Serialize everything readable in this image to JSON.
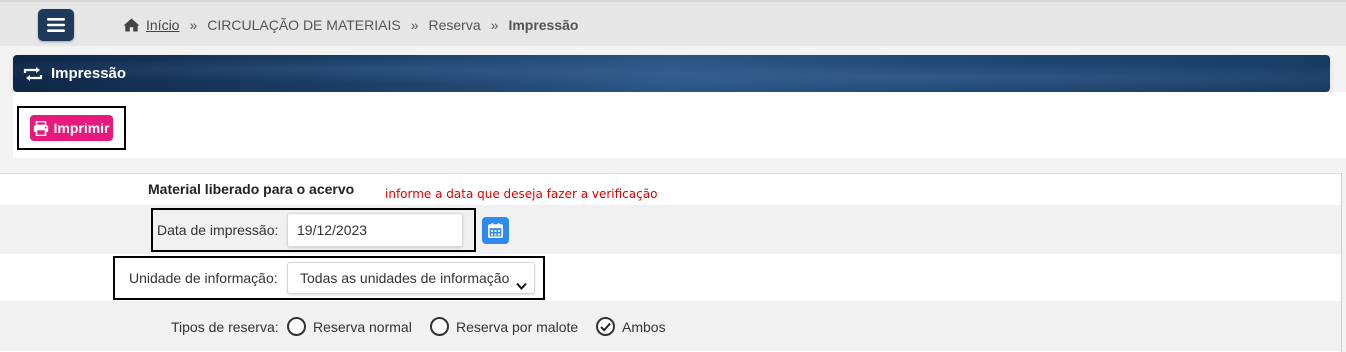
{
  "breadcrumb": {
    "home_label": "Início",
    "separator": "»",
    "items": [
      "CIRCULAÇÃO DE MATERIAIS",
      "Reserva"
    ],
    "current": "Impressão"
  },
  "header": {
    "title": "Impressão"
  },
  "toolbar": {
    "print_label": "Imprimir"
  },
  "form": {
    "section_title": "Material liberado para o acervo",
    "hint": "informe a data que deseja fazer a verificação",
    "date": {
      "label": "Data de impressão:",
      "value": "19/12/2023"
    },
    "unit": {
      "label": "Unidade de informação:",
      "selected": "Todas as unidades de informação"
    },
    "reserve_types": {
      "label": "Tipos de reserva:",
      "options": [
        {
          "label": "Reserva normal",
          "checked": false
        },
        {
          "label": "Reserva por malote",
          "checked": false
        },
        {
          "label": "Ambos",
          "checked": true
        }
      ]
    }
  },
  "icons": {
    "menu": "hamburger-icon",
    "home": "home-icon",
    "title": "repeat-icon",
    "print": "printer-icon",
    "calendar": "calendar-icon",
    "select": "chevron-down-icon"
  },
  "colors": {
    "menu_button": "#1d3a5c",
    "print_button": "#e8197c",
    "calendar_button": "#2e8bee",
    "hint_text": "#e00000",
    "title_bar": "#1b3e66"
  }
}
